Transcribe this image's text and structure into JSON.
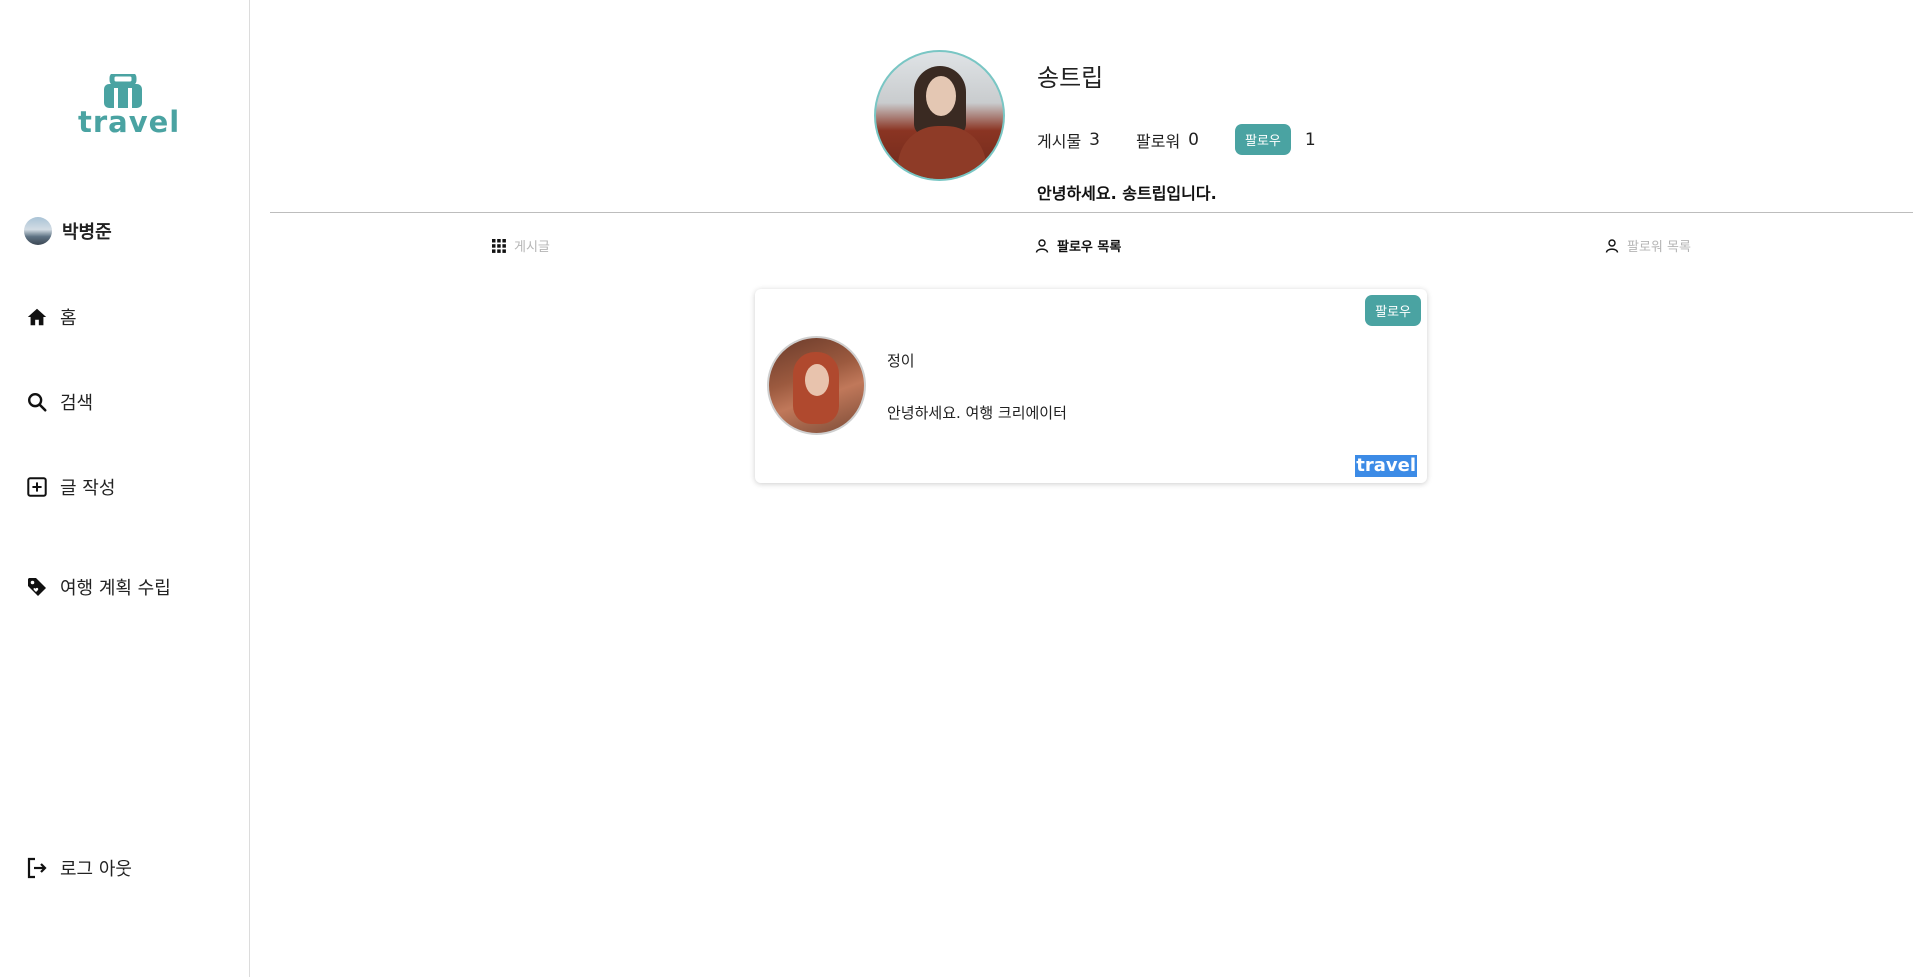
{
  "sidebar": {
    "logo_text": "travel",
    "user_name": "박병준",
    "items": [
      {
        "label": "홈",
        "icon": "home-icon"
      },
      {
        "label": "검색",
        "icon": "search-icon"
      },
      {
        "label": "글 작성",
        "icon": "add-post-icon"
      },
      {
        "label": "여행 계획 수립",
        "icon": "tag-icon"
      }
    ],
    "logout_label": "로그 아웃"
  },
  "profile": {
    "name": "송트립",
    "posts_label": "게시물",
    "posts_count": "3",
    "followers_label": "팔로워",
    "followers_count": "0",
    "following_label": "팔로우",
    "following_count": "1",
    "bio": "안녕하세요. 송트립입니다."
  },
  "tabs": [
    {
      "label": "게시글",
      "icon": "grid-icon",
      "active": false
    },
    {
      "label": "팔로우 목록",
      "icon": "person-icon",
      "active": true
    },
    {
      "label": "팔로워 목록",
      "icon": "person-icon",
      "active": false
    }
  ],
  "follow_list": [
    {
      "name": "정이",
      "bio": "안녕하세요. 여행 크리에이터",
      "follow_button": "팔로우",
      "tag": "travel"
    }
  ],
  "colors": {
    "accent": "#4aa3a2",
    "highlight": "#3c8be6"
  }
}
